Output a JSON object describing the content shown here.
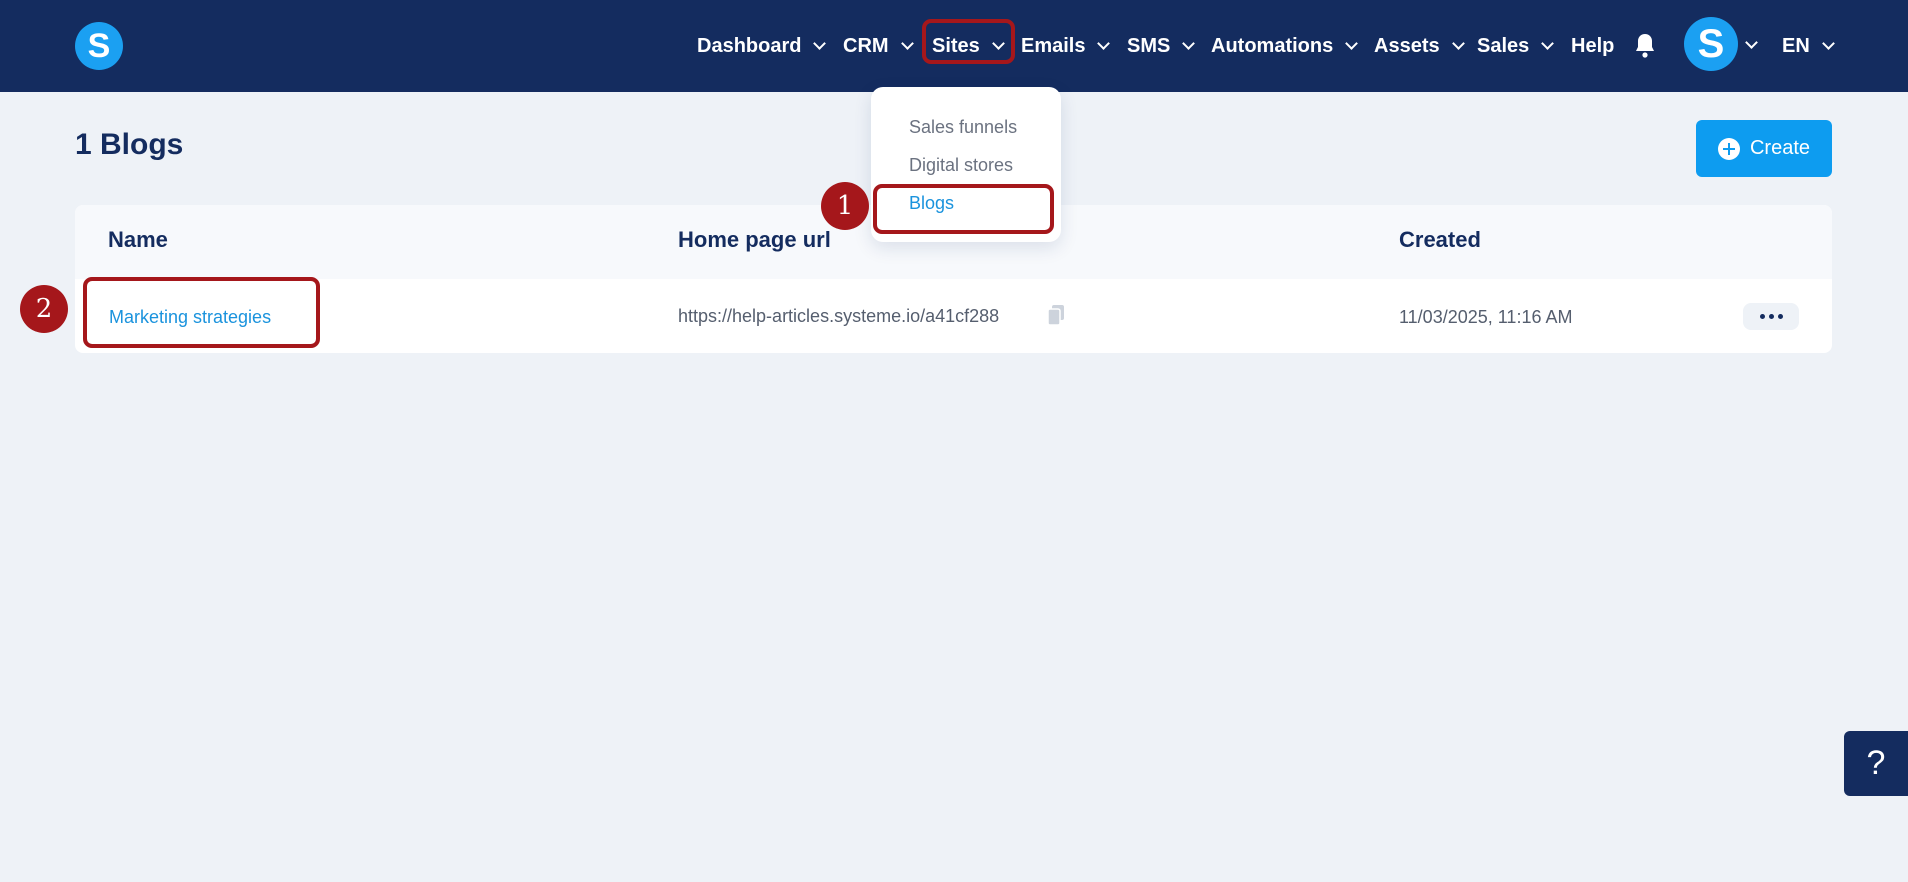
{
  "brand": {
    "logo_letter": "S"
  },
  "nav": {
    "items": [
      {
        "label": "Dashboard"
      },
      {
        "label": "CRM"
      },
      {
        "label": "Sites"
      },
      {
        "label": "Emails"
      },
      {
        "label": "SMS"
      },
      {
        "label": "Automations"
      },
      {
        "label": "Assets"
      },
      {
        "label": "Sales"
      },
      {
        "label": "Help"
      }
    ],
    "avatar_letter": "S",
    "language": "EN"
  },
  "dropdown": {
    "items": [
      {
        "label": "Sales funnels"
      },
      {
        "label": "Digital stores"
      },
      {
        "label": "Blogs"
      }
    ]
  },
  "annotations": {
    "step1": "1",
    "step2": "2"
  },
  "page": {
    "title": "1 Blogs",
    "create_label": "Create"
  },
  "table": {
    "headers": [
      "Name",
      "Home page url",
      "Created"
    ],
    "rows": [
      {
        "name": "Marketing strategies",
        "url": "https://help-articles.systeme.io/a41cf288",
        "created": "11/03/2025, 11:16 AM"
      }
    ]
  },
  "help_widget": {
    "label": "?"
  },
  "colors": {
    "navbar": "#142c5f",
    "accent": "#0d9cf0",
    "highlight": "#a5171b",
    "link": "#1a93dd"
  }
}
